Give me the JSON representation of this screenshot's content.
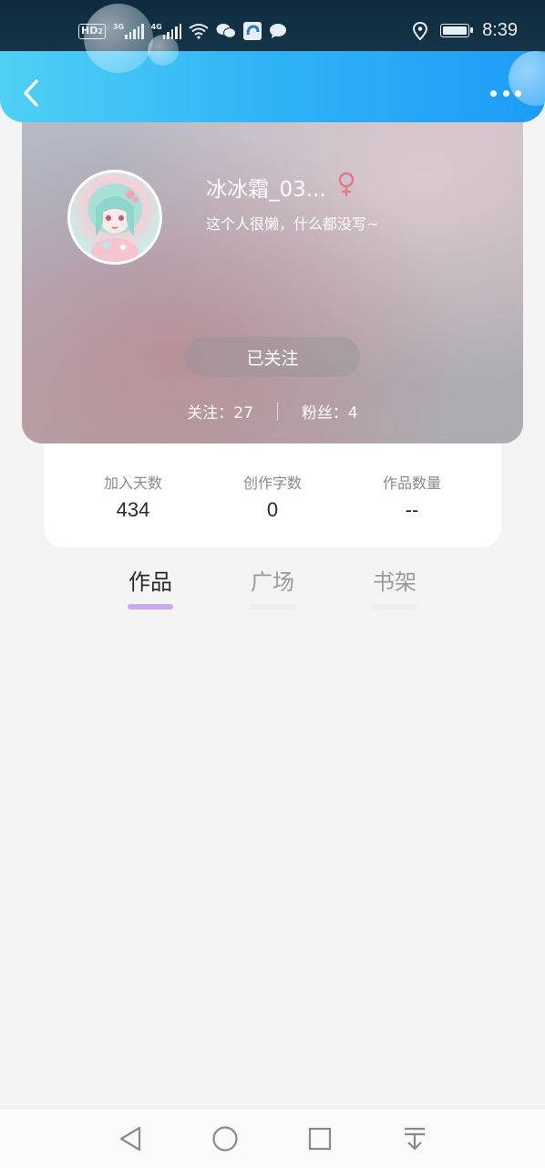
{
  "status_bar": {
    "hd_label": "HD",
    "sim_label": "2",
    "net1_label": "3G",
    "net2_label": "4G",
    "time": "8:39",
    "icons": [
      "hd-icon",
      "signal-icon",
      "wifi-icon",
      "wechat-icon",
      "app-icon",
      "message-icon",
      "location-icon",
      "battery-icon"
    ]
  },
  "header": {
    "back_icon": "chevron-left-icon",
    "more_icon": "more-dots-icon"
  },
  "profile": {
    "nickname": "冰冰霜_03...",
    "gender_icon": "female-icon",
    "gender_color": "#e07a8a",
    "bio": "这个人很懒，什么都没写~",
    "follow_button": "已关注",
    "following_label": "关注：",
    "following_count": "27",
    "fans_label": "粉丝：",
    "fans_count": "4"
  },
  "stats": [
    {
      "label": "加入天数",
      "value": "434"
    },
    {
      "label": "创作字数",
      "value": "0"
    },
    {
      "label": "作品数量",
      "value": "--"
    }
  ],
  "tabs": [
    {
      "label": "作品",
      "active": true
    },
    {
      "label": "广场",
      "active": false
    },
    {
      "label": "书架",
      "active": false
    }
  ],
  "colors": {
    "header_start": "#4fd0f5",
    "header_end": "#1d9cf6",
    "tab_indicator": "#c9aaf0",
    "background": "#f4f4f4"
  },
  "navbar": {
    "icons": [
      "nav-back-icon",
      "nav-home-icon",
      "nav-recents-icon",
      "nav-notification-icon"
    ]
  }
}
